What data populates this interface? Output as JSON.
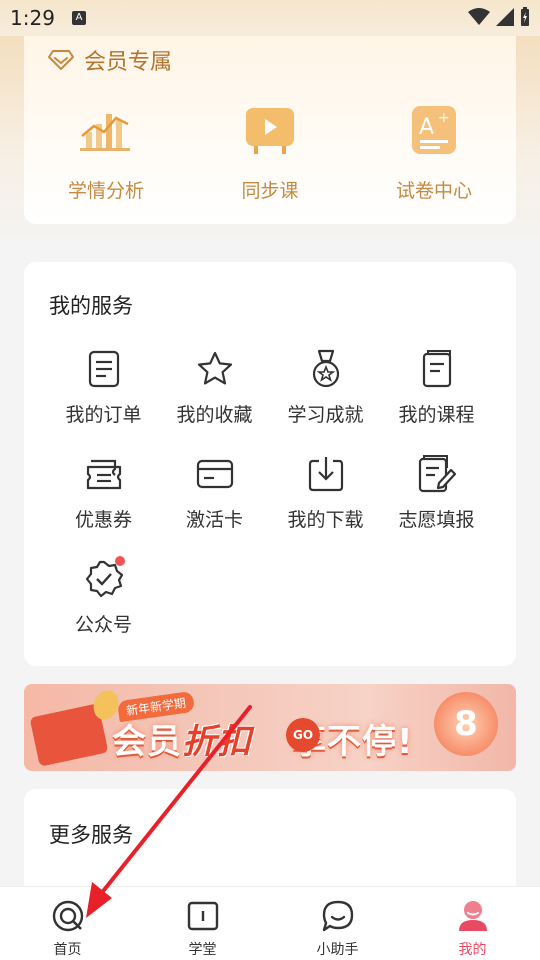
{
  "status_bar": {
    "time": "1:29",
    "notification_letter": "A"
  },
  "vip": {
    "title": "会员专属",
    "items": [
      {
        "label": "学情分析",
        "icon": "analysis-chart-icon"
      },
      {
        "label": "同步课",
        "icon": "video-board-icon"
      },
      {
        "label": "试卷中心",
        "icon": "exam-paper-icon"
      }
    ]
  },
  "services": {
    "title": "我的服务",
    "items": [
      {
        "label": "我的订单",
        "icon": "order-icon"
      },
      {
        "label": "我的收藏",
        "icon": "star-icon"
      },
      {
        "label": "学习成就",
        "icon": "medal-icon"
      },
      {
        "label": "我的课程",
        "icon": "course-book-icon"
      },
      {
        "label": "优惠券",
        "icon": "coupon-icon"
      },
      {
        "label": "激活卡",
        "icon": "card-icon"
      },
      {
        "label": "我的下载",
        "icon": "download-icon"
      },
      {
        "label": "志愿填报",
        "icon": "form-edit-icon"
      },
      {
        "label": "公众号",
        "icon": "verified-badge-icon"
      }
    ]
  },
  "banner": {
    "tag": "新年新学期",
    "text_left": "会员",
    "text_mid": "折扣",
    "go": "GO",
    "text_right": "享不停!",
    "badge": "8"
  },
  "more": {
    "title": "更多服务"
  },
  "nav": {
    "items": [
      {
        "label": "首页",
        "icon": "home-icon"
      },
      {
        "label": "学堂",
        "icon": "book-icon"
      },
      {
        "label": "小助手",
        "icon": "chat-icon"
      },
      {
        "label": "我的",
        "icon": "profile-icon",
        "active": true
      }
    ]
  },
  "colors": {
    "accent": "#e84a64",
    "vip_gold": "#c58a3f",
    "arrow": "#e8202a"
  }
}
